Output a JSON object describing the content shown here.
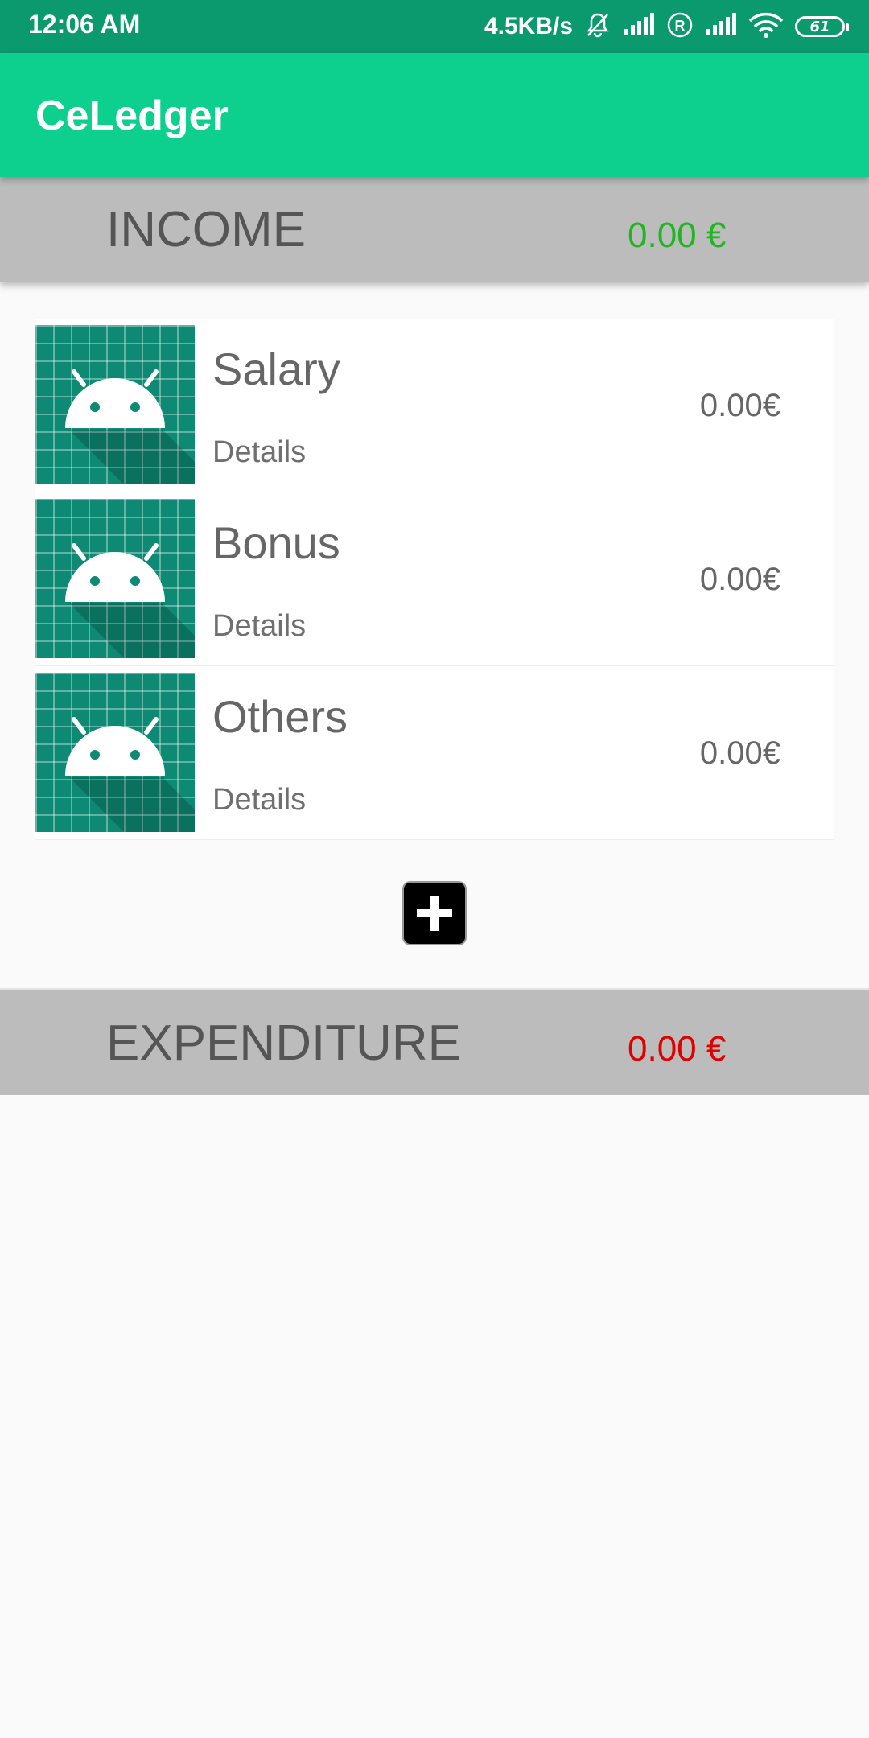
{
  "status_bar": {
    "time": "12:06 AM",
    "network_speed": "4.5KB/s",
    "battery_level": "61",
    "icons": [
      "mute-icon",
      "signal-icon",
      "roaming-icon",
      "signal-icon",
      "wifi-icon",
      "battery-icon"
    ]
  },
  "app_bar": {
    "title": "CeLedger"
  },
  "income": {
    "title": "INCOME",
    "total": "0.00 €",
    "total_color": "#22b522",
    "items": [
      {
        "name": "Salary",
        "details": "Details",
        "amount": "0.00€",
        "icon": "android-icon"
      },
      {
        "name": "Bonus",
        "details": "Details",
        "amount": "0.00€",
        "icon": "android-icon"
      },
      {
        "name": "Others",
        "details": "Details",
        "amount": "0.00€",
        "icon": "android-icon"
      }
    ],
    "add_icon": "plus-icon"
  },
  "expenditure": {
    "title": "EXPENDITURE",
    "total": "0.00 €",
    "total_color": "#e00000"
  },
  "colors": {
    "status_bar": "#0a9a6e",
    "app_bar": "#0dcf8e",
    "section_header": "#bbbcbb",
    "thumbnail": "#0e8a74"
  }
}
